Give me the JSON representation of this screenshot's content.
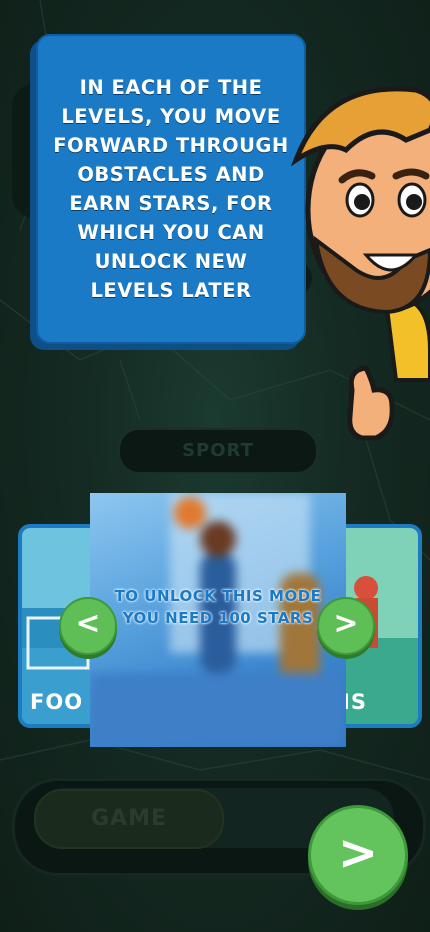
{
  "tutorial": {
    "message": "IN EACH OF THE LEVELS, YOU MOVE FORWARD THROUGH OBSTACLES AND EARN STARS, FOR WHICH YOU CAN UNLOCK NEW LEVELS LATER"
  },
  "category": {
    "label": "SPORT"
  },
  "carousel": {
    "left_card_label": "FOO",
    "right_card_label": "IS",
    "locked_message": "TO UNLOCK THIS MODE YOU NEED 100 STARS",
    "prev_label": "<",
    "next_label": ">"
  },
  "footer": {
    "mode_label": "GAME",
    "play_label": ">"
  },
  "colors": {
    "accent_blue": "#1a7ac6",
    "button_green": "#5dbf55",
    "background": "#142a22"
  }
}
